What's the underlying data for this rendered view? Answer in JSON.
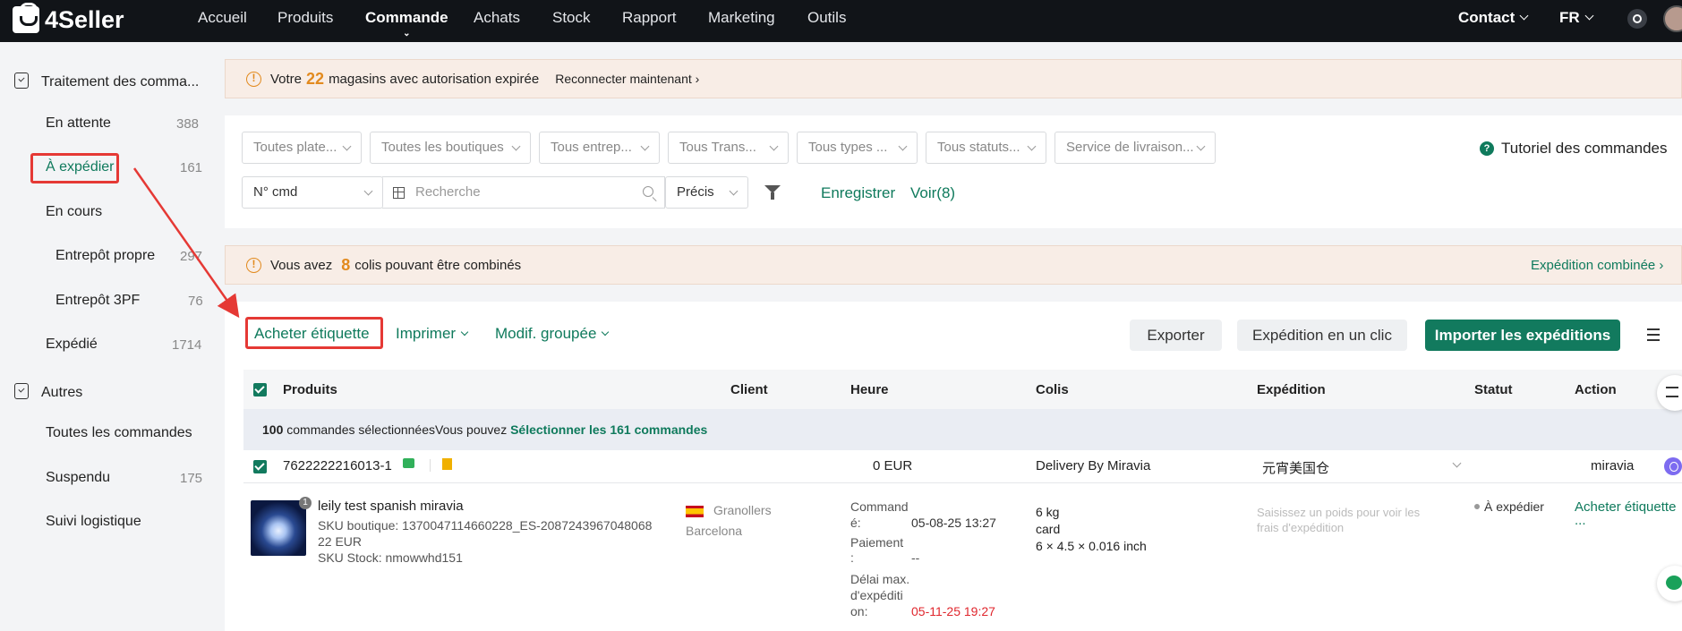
{
  "brand": {
    "name": "4Seller"
  },
  "nav": {
    "items": [
      "Accueil",
      "Produits",
      "Commande",
      "Achats",
      "Stock",
      "Rapport",
      "Marketing",
      "Outils"
    ],
    "active": "Commande",
    "contact": "Contact",
    "language": "FR"
  },
  "sidebar": {
    "group1": "Traitement des comma...",
    "items": [
      {
        "label": "En attente",
        "count": "388"
      },
      {
        "label": "À expédier",
        "count": "161"
      },
      {
        "label": "En cours",
        "count": ""
      },
      {
        "label": "Entrepôt propre",
        "count": "297"
      },
      {
        "label": "Entrepôt 3PF",
        "count": "76"
      },
      {
        "label": "Expédié",
        "count": "1714"
      }
    ],
    "group2": "Autres",
    "items2": [
      {
        "label": "Toutes les commandes",
        "count": ""
      },
      {
        "label": "Suspendu",
        "count": "175"
      },
      {
        "label": "Suivi logistique",
        "count": ""
      }
    ]
  },
  "banner_auth": {
    "prefix": "Votre",
    "number": "22",
    "suffix": "magasins avec autorisation expirée",
    "link": "Reconnecter maintenant"
  },
  "filters": {
    "dropdowns": [
      "Toutes plate...",
      "Toutes les boutiques",
      "Tous entrep...",
      "Tous Trans...",
      "Tous types ...",
      "Tous statuts...",
      "Service de livraison..."
    ],
    "tutorial": "Tutoriel des commandes",
    "search_field": "N° cmd",
    "search_placeholder": "Recherche",
    "match_mode": "Précis",
    "save": "Enregistrer",
    "view": "Voir(8)"
  },
  "banner_combine": {
    "prefix": "Vous avez",
    "number": "8",
    "suffix": "colis pouvant être combinés",
    "link": "Expédition combinée"
  },
  "toolbar": {
    "buy_label": "Acheter étiquette",
    "print": "Imprimer",
    "bulk_edit": "Modif. groupée",
    "export": "Exporter",
    "one_click": "Expédition en un clic",
    "import": "Importer les expéditions"
  },
  "table": {
    "headers": [
      "Produits",
      "Client",
      "Heure",
      "Colis",
      "Expédition",
      "Statut",
      "Action"
    ],
    "selection": {
      "count": "100",
      "text": "commandes sélectionnées",
      "hint": "Vous pouvez",
      "link": "Sélectionner les 161 commandes"
    },
    "order": {
      "id": "7622222216013-1",
      "amount": "0 EUR",
      "delivery": "Delivery By Miravia",
      "warehouse": "元宵美国仓",
      "platform": "miravia",
      "product_qty": "1",
      "product_name": "leily test spanish miravia",
      "sku_shop": "SKU boutique: 1370047114660228_ES-2087243967048068",
      "price": "22 EUR",
      "sku_stock": "SKU Stock: nmowwhd151",
      "client_city": "Granollers",
      "client_region": "Barcelona",
      "time_ordered_label_1": "Command",
      "time_ordered_label_2": "é:",
      "time_ordered": "05-08-25 13:27",
      "payment_label_1": "Paiement",
      "payment_label_2": ":",
      "payment": "--",
      "deadline_label_1": "Délai max.",
      "deadline_label_2": "d'expéditi",
      "deadline_label_3": "on:",
      "deadline": "05-11-25 19:27",
      "weight": "6 kg",
      "package": "card",
      "dimensions": "6 × 4.5 × 0.016 inch",
      "shipping_hint_1": "Saisissez un poids pour voir les",
      "shipping_hint_2": "frais d'expédition",
      "status": "À expédier",
      "action": "Acheter étiquette",
      "action_more": "..."
    }
  },
  "colors": {
    "accent": "#127a5e",
    "warning": "#e28a1e",
    "highlight": "#e53935"
  }
}
